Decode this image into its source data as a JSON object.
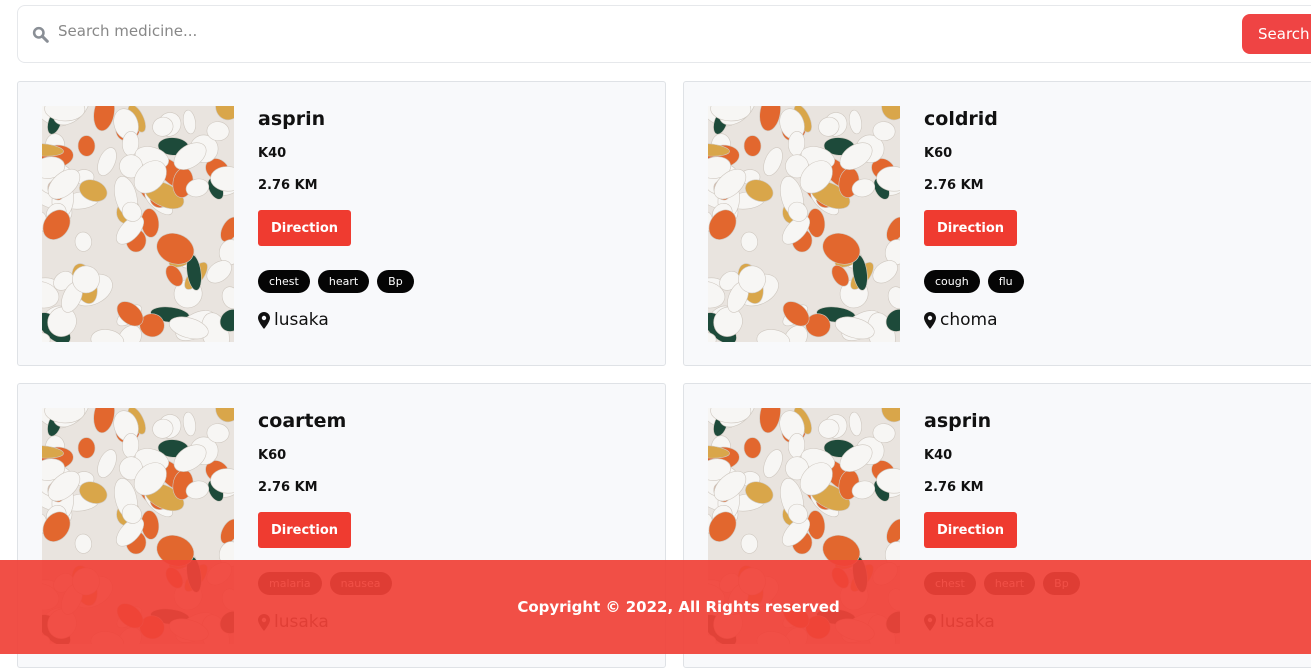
{
  "search": {
    "placeholder": "Search medicine...",
    "button": "Search"
  },
  "cards": [
    {
      "name": "asprin",
      "price": "K40",
      "distance": "2.76 KM",
      "button": "Direction",
      "tags": [
        "chest",
        "heart",
        "Bp"
      ],
      "location": "lusaka"
    },
    {
      "name": "coldrid",
      "price": "K60",
      "distance": "2.76 KM",
      "button": "Direction",
      "tags": [
        "cough",
        "flu"
      ],
      "location": "choma"
    },
    {
      "name": "coartem",
      "price": "K60",
      "distance": "2.76 KM",
      "button": "Direction",
      "tags": [
        "malaria",
        "nausea"
      ],
      "location": "lusaka"
    },
    {
      "name": "asprin",
      "price": "K40",
      "distance": "2.76 KM",
      "button": "Direction",
      "tags": [
        "chest",
        "heart",
        "Bp"
      ],
      "location": "lusaka"
    }
  ],
  "footer": {
    "text": "Copyright © 2022, All Rights reserved"
  },
  "colors": {
    "accent": "#ef4444",
    "tag": "#050505"
  }
}
